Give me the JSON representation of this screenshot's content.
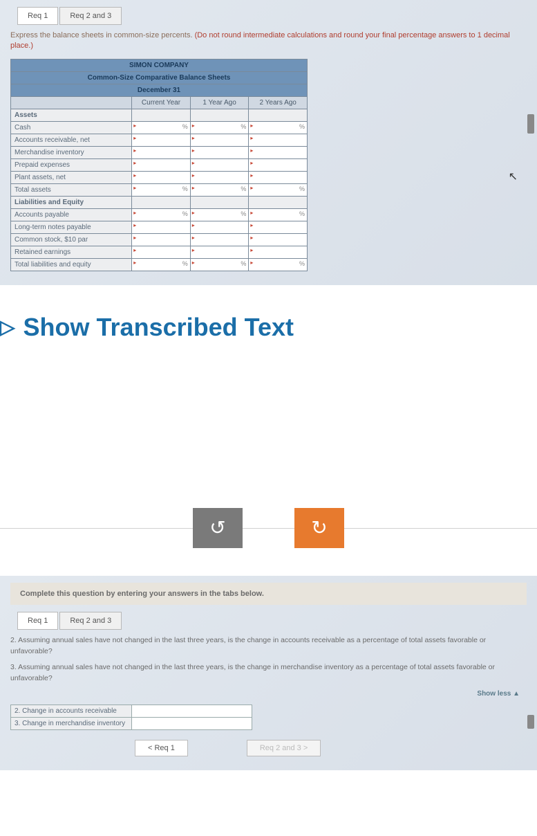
{
  "panel1": {
    "tabs": {
      "req1": "Req 1",
      "req23": "Req 2 and 3"
    },
    "instruction_main": "Express the balance sheets in common-size percents. ",
    "instruction_red": "(Do not round intermediate calculations and round your final percentage answers to 1 decimal place.)",
    "table": {
      "company": "SIMON COMPANY",
      "title": "Common-Size Comparative Balance Sheets",
      "date": "December 31",
      "col1": "Current Year",
      "col2": "1 Year Ago",
      "col3": "2 Years Ago",
      "rows": [
        {
          "label": "Assets",
          "section": true
        },
        {
          "label": "Cash",
          "pct": true
        },
        {
          "label": "Accounts receivable, net"
        },
        {
          "label": "Merchandise inventory"
        },
        {
          "label": "Prepaid expenses"
        },
        {
          "label": "Plant assets, net"
        },
        {
          "label": "Total assets",
          "pct": true
        },
        {
          "label": "Liabilities and Equity",
          "section": true
        },
        {
          "label": "Accounts payable",
          "pct": true
        },
        {
          "label": "Long-term notes payable"
        },
        {
          "label": "Common stock, $10 par"
        },
        {
          "label": "Retained earnings"
        },
        {
          "label": "Total liabilities and equity",
          "pct": true
        }
      ]
    },
    "pct_symbol": "%"
  },
  "transcribed": {
    "heading": "Show Transcribed Text",
    "tri": "▷"
  },
  "refresh": {
    "undo": "↺",
    "redo": "↻"
  },
  "panel2": {
    "banner": "Complete this question by entering your answers in the tabs below.",
    "tabs": {
      "req1": "Req 1",
      "req23": "Req 2 and 3"
    },
    "q2": "2. Assuming annual sales have not changed in the last three years, is the change in accounts receivable as a percentage of total assets favorable or unfavorable?",
    "q3": "3. Assuming annual sales have not changed in the last three years, is the change in merchandise inventory as a percentage of total assets favorable or unfavorable?",
    "showless": "Show less ▲",
    "ans_rows": {
      "r2": "2. Change in accounts receivable",
      "r3": "3. Change in merchandise inventory"
    },
    "nav": {
      "prev": "<   Req 1",
      "next": "Req 2 and 3   >"
    }
  }
}
